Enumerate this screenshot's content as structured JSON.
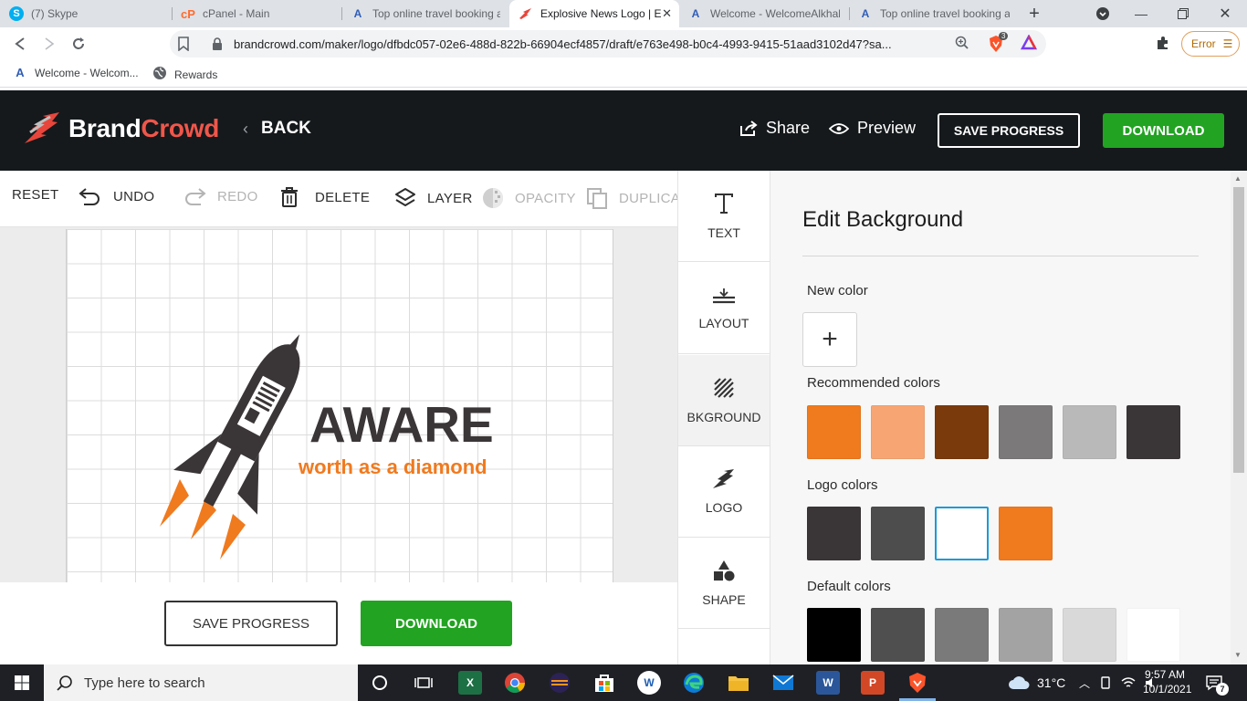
{
  "browser": {
    "tabs": [
      {
        "title": "(7) Skype",
        "icon": "skype-icon",
        "active": false
      },
      {
        "title": "cPanel - Main",
        "icon": "cpanel-icon",
        "active": false
      },
      {
        "title": "Top online travel booking ag",
        "icon": "site-a-icon",
        "active": false
      },
      {
        "title": "Explosive News Logo | E",
        "icon": "brandcrowd-icon",
        "active": true
      },
      {
        "title": "Welcome - WelcomeAlkhale",
        "icon": "site-a-icon",
        "active": false
      },
      {
        "title": "Top online travel booking ag",
        "icon": "site-a-icon",
        "active": false
      }
    ],
    "url": "brandcrowd.com/maker/logo/dfbdc057-02e6-488d-822b-66904ecf4857/draft/e763e498-b0c4-4993-9415-51aad3102d47?sa...",
    "shield_count": "3",
    "error_label": "Error",
    "bookmarks": [
      {
        "label": "Welcome - Welcom...",
        "icon": "site-a-icon"
      },
      {
        "label": "Rewards",
        "icon": "globe-icon"
      }
    ]
  },
  "header": {
    "brand_part1": "Brand",
    "brand_part2": "Crowd",
    "back_label": "BACK",
    "share_label": "Share",
    "preview_label": "Preview",
    "save_label": "SAVE PROGRESS",
    "download_label": "DOWNLOAD"
  },
  "toolbar": {
    "reset": "RESET",
    "undo": "UNDO",
    "redo": "REDO",
    "delete": "DELETE",
    "layer": "LAYER",
    "opacity": "OPACITY",
    "duplicate": "DUPLICA"
  },
  "canvas": {
    "logo_title": "AWARE",
    "logo_tagline": "worth as a diamond",
    "colors": {
      "dark": "#3a3536",
      "orange": "#f07a1e"
    }
  },
  "bottom": {
    "save_label": "SAVE PROGRESS",
    "download_label": "DOWNLOAD"
  },
  "side_tools": [
    {
      "label": "TEXT",
      "icon": "text-icon"
    },
    {
      "label": "LAYOUT",
      "icon": "layout-icon"
    },
    {
      "label": "BKGROUND",
      "icon": "background-icon",
      "active": true
    },
    {
      "label": "LOGO",
      "icon": "logo-icon"
    },
    {
      "label": "SHAPE",
      "icon": "shape-icon"
    }
  ],
  "panel": {
    "title": "Edit Background",
    "new_color_label": "New color",
    "add_symbol": "+",
    "recommended_label": "Recommended colors",
    "recommended": [
      "#f07a1e",
      "#f7a673",
      "#7a3a0c",
      "#7b7979",
      "#b9b9b9",
      "#3a3536"
    ],
    "logo_colors_label": "Logo colors",
    "logo_colors": [
      "#3a3536",
      "#4d4d4d",
      "#ffffff",
      "#f07a1e"
    ],
    "default_label": "Default colors",
    "default_colors": [
      "#000000",
      "#4f4f4f",
      "#7a7a7a",
      "#a3a3a3",
      "#d9d9d9",
      "#ffffff"
    ]
  },
  "taskbar": {
    "search_placeholder": "Type here to search",
    "temperature": "31°C",
    "time": "9:57 AM",
    "date": "10/1/2021",
    "notif_count": "7"
  }
}
